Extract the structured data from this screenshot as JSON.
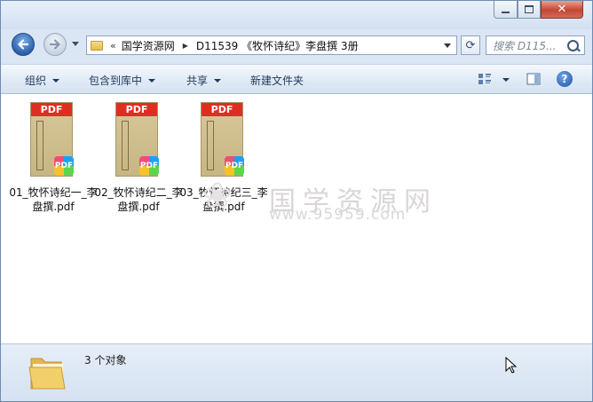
{
  "window": {
    "controls": {
      "minimize_icon": "minimize-icon",
      "maximize_icon": "maximize-icon",
      "close_icon": "close-icon",
      "close_glyph": "✕"
    }
  },
  "address": {
    "overflow": "«",
    "crumbs": [
      "国学资源网",
      "D11539 《牧怀诗纪》李盘撰 3册"
    ]
  },
  "search": {
    "placeholder": "搜索 D115..."
  },
  "toolbar": {
    "organize": "组织",
    "include_in_library": "包含到库中",
    "share": "共享",
    "new_folder": "新建文件夹"
  },
  "files": [
    {
      "name": "01_牧怀诗纪一_李盘撰.pdf",
      "band": "PDF",
      "badge": "PDF"
    },
    {
      "name": "02_牧怀诗纪二_李盘撰.pdf",
      "band": "PDF",
      "badge": "PDF"
    },
    {
      "name": "03_牧怀诗纪三_李盘撰.pdf",
      "band": "PDF",
      "badge": "PDF"
    }
  ],
  "watermark": {
    "text": "国学资源网",
    "url": "www.95959.com"
  },
  "status": {
    "count_text": "3 个对象"
  },
  "colors": {
    "accent": "#1e395b",
    "pdf_red": "#e02d22",
    "window_border": "#6d8bb0"
  }
}
